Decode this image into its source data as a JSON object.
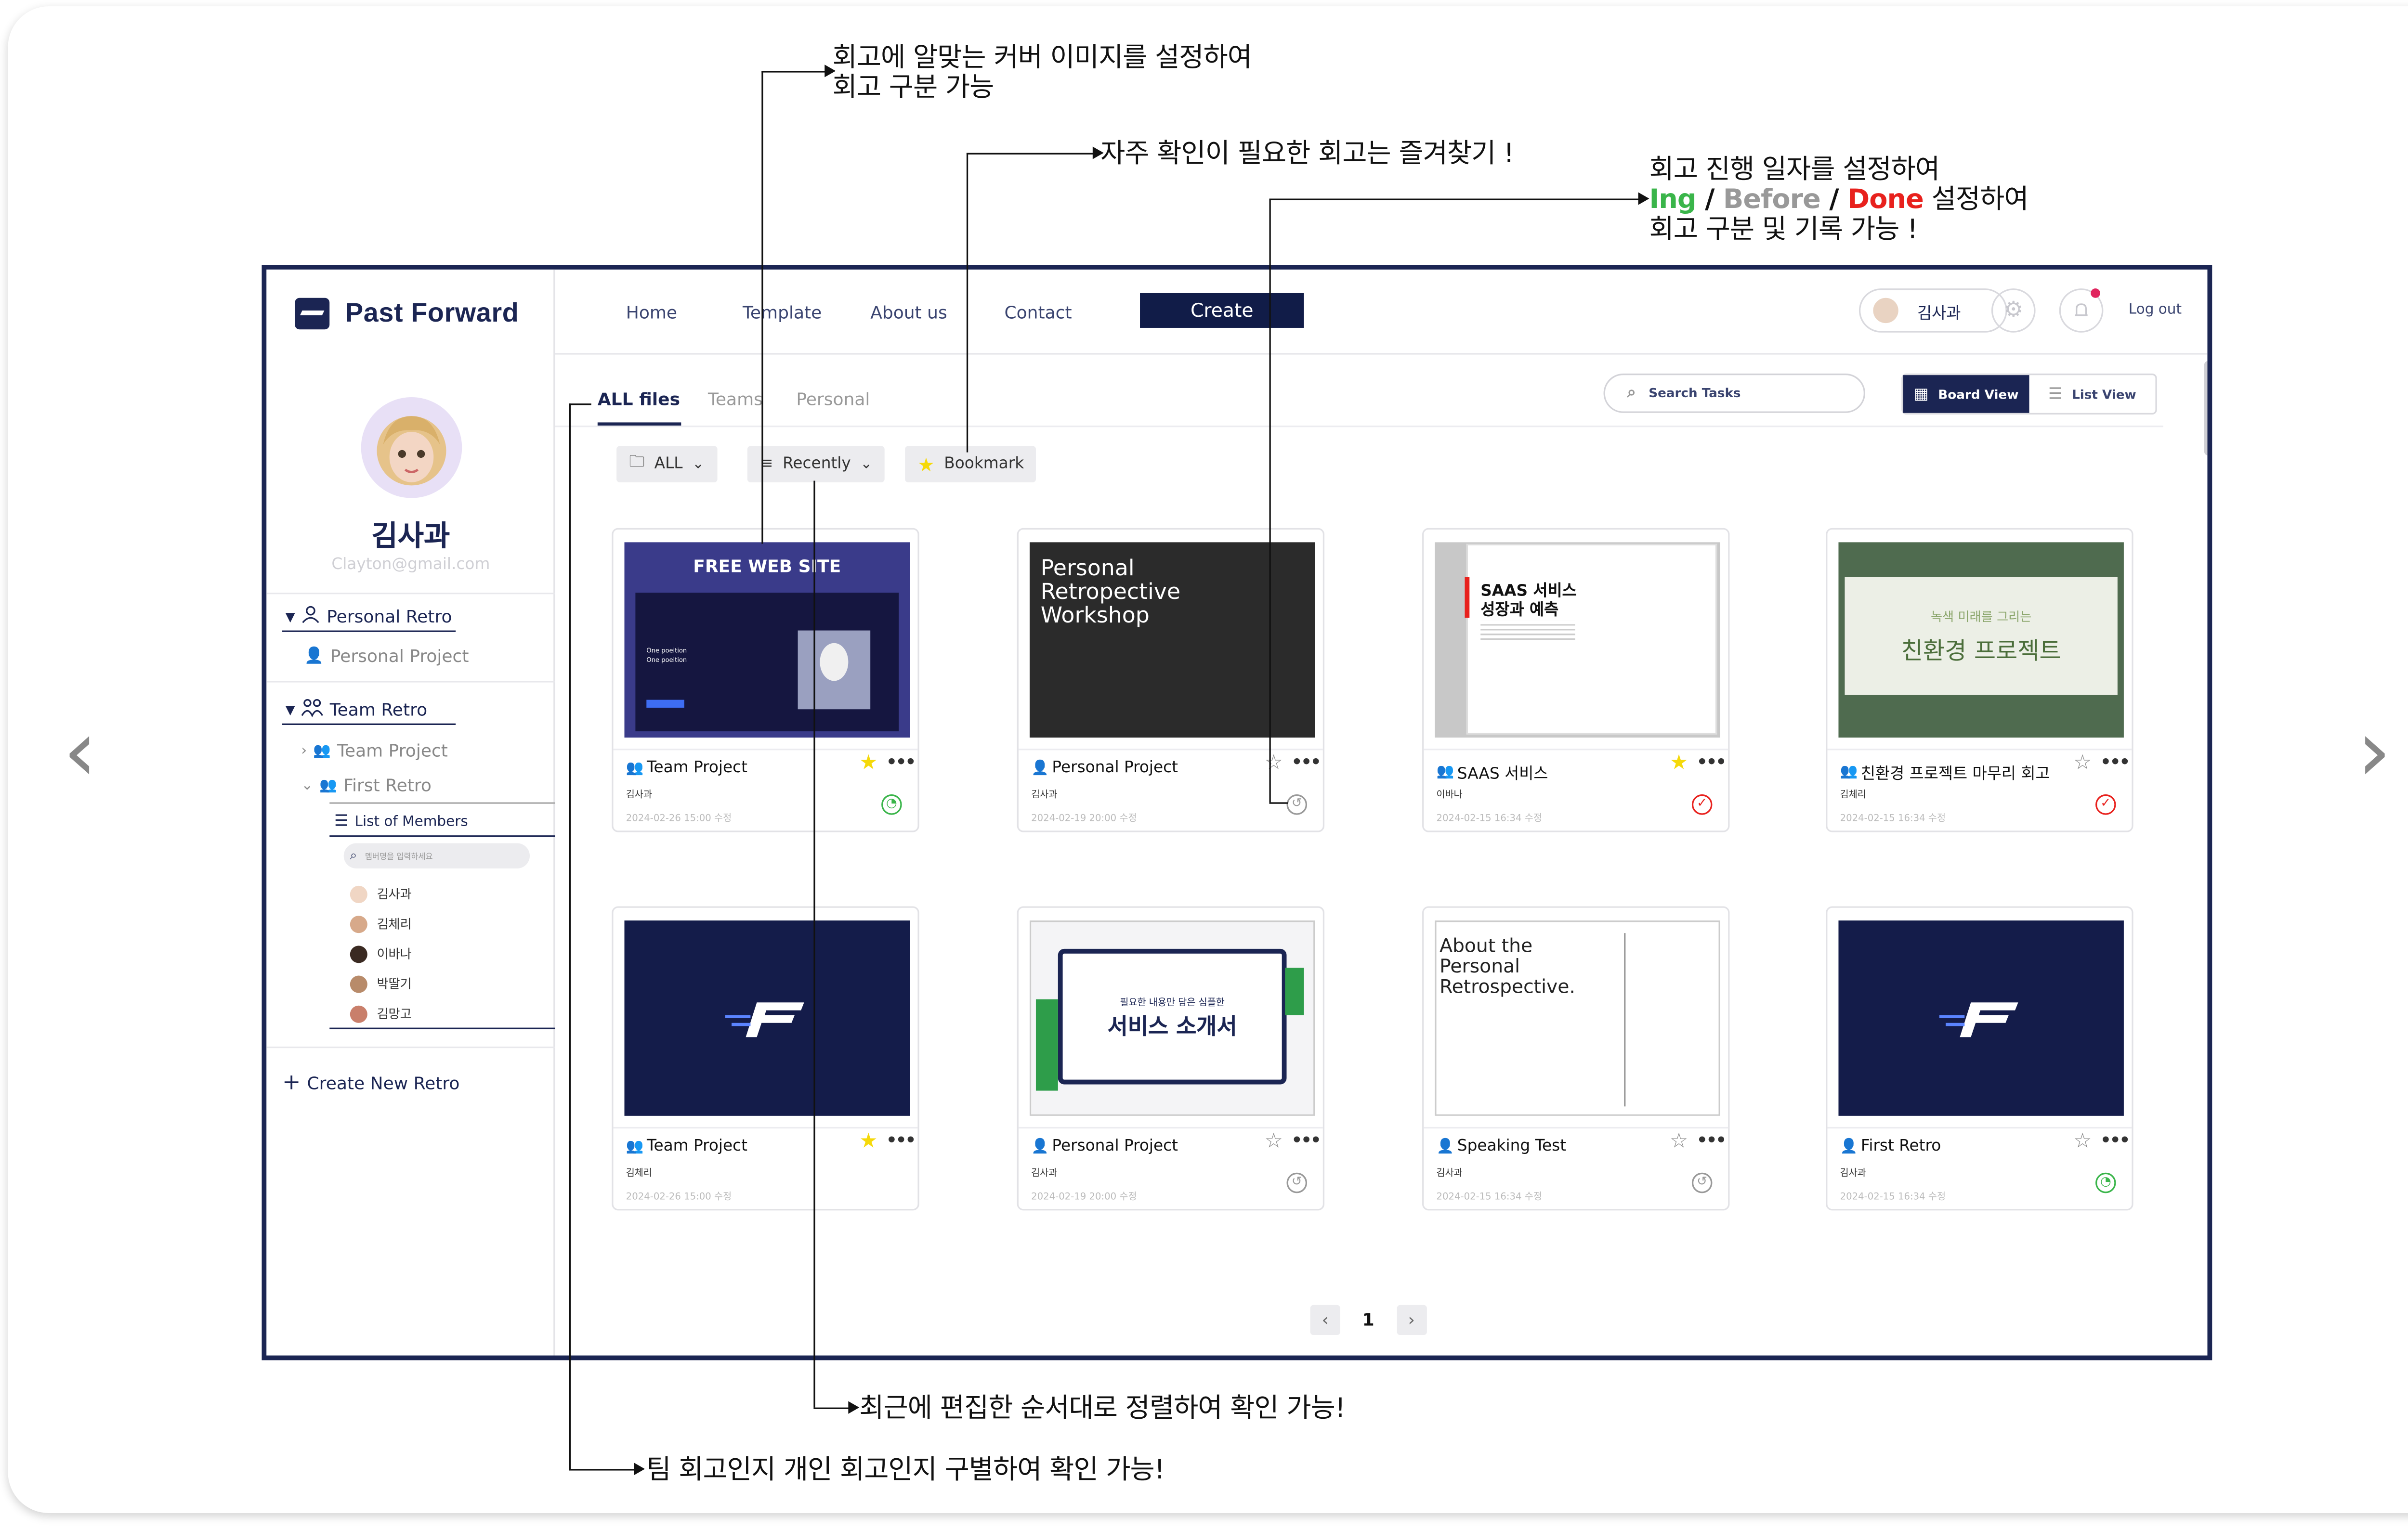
{
  "annotations": {
    "cover": [
      "회고에 알맞는 커버 이미지를 설정하여",
      "회고 구분 가능"
    ],
    "bookmark": "자주 확인이 필요한 회고는 즐겨찾기 !",
    "status_line1": "회고 진행 일자를 설정하여",
    "status_ing": "Ing",
    "status_before": "Before",
    "status_done": "Done",
    "status_slash": " / ",
    "status_suffix": " 설정하여",
    "status_line3": "회고 구분 및 기록 가능 !",
    "recent": "최근에 편집한 순서대로 정렬하여 확인 가능!",
    "team": "팀 회고인지 개인 회고인지 구별하여 확인 가능!"
  },
  "colors": {
    "navy": "#1b2553",
    "ing": "#3ab54a",
    "before": "#999999",
    "done": "#e8211d",
    "star": "#f5d90a"
  },
  "app": {
    "name": "Past Forward"
  },
  "profile": {
    "name": "김사과",
    "email": "Clayton@gmail.com"
  },
  "sidebar": {
    "personal_retro": "Personal Retro",
    "personal_project": "Personal Project",
    "team_retro": "Team Retro",
    "team_project": "Team Project",
    "first_retro": "First Retro",
    "list_of_members": "List of Members",
    "member_search_placeholder": "멤버명을 입력하세요",
    "members": [
      "김사과",
      "김체리",
      "이바나",
      "박딸기",
      "김망고"
    ],
    "create_new_retro": "Create New Retro"
  },
  "nav": {
    "home": "Home",
    "template": "Template",
    "about": "About us",
    "contact": "Contact",
    "create": "Create",
    "user_chip": "김사과",
    "logout": "Log out"
  },
  "tabs": {
    "all": "ALL files",
    "teams": "Teams",
    "personal": "Personal"
  },
  "search": {
    "placeholder": "Search Tasks"
  },
  "views": {
    "board": "Board View",
    "list": "List View"
  },
  "filters": {
    "all": "ALL",
    "recently": "Recently",
    "bookmark": "Bookmark"
  },
  "cards": [
    {
      "title": "Team Project",
      "author": "김사과",
      "date": "2024-02-26 15:00 수정",
      "type": "team",
      "bookmarked": true,
      "status": "ing",
      "cover": {
        "heading": "FREE WEB SITE",
        "line1": "One poeition",
        "line2": "One poeition"
      }
    },
    {
      "title": "Personal Project",
      "author": "김사과",
      "date": "2024-02-19 20:00 수정",
      "type": "personal",
      "bookmarked": false,
      "status": "before",
      "cover": {
        "text": "Personal Retropective Workshop"
      }
    },
    {
      "title": "SAAS 서비스",
      "author": "이바나",
      "date": "2024-02-15 16:34 수정",
      "type": "team",
      "bookmarked": true,
      "status": "done",
      "cover": {
        "line1": "SAAS 서비스",
        "line2": "성장과 예측"
      }
    },
    {
      "title": "친환경 프로젝트 마무리 회고",
      "author": "김체리",
      "date": "2024-02-15 16:34 수정",
      "type": "team",
      "bookmarked": false,
      "status": "done",
      "cover": {
        "small": "녹색 미래를 그리는",
        "big": "친환경 프로젝트"
      }
    },
    {
      "title": "Team Project",
      "author": "김체리",
      "date": "2024-02-26 15:00 수정",
      "type": "team",
      "bookmarked": true,
      "status": "none",
      "cover": {}
    },
    {
      "title": "Personal Project",
      "author": "김사과",
      "date": "2024-02-19 20:00 수정",
      "type": "personal",
      "bookmarked": false,
      "status": "before",
      "cover": {
        "small": "필요한 내용만 담은 심플한",
        "big": "서비스 소개서"
      }
    },
    {
      "title": "Speaking Test",
      "author": "김사과",
      "date": "2024-02-15 16:34 수정",
      "type": "personal",
      "bookmarked": false,
      "status": "before",
      "cover": {
        "text": "About the Personal Retrospective."
      }
    },
    {
      "title": "First Retro",
      "author": "김사과",
      "date": "2024-02-15 16:34 수정",
      "type": "personal",
      "bookmarked": false,
      "status": "ing",
      "cover": {}
    }
  ],
  "pagination": {
    "current": "1"
  }
}
